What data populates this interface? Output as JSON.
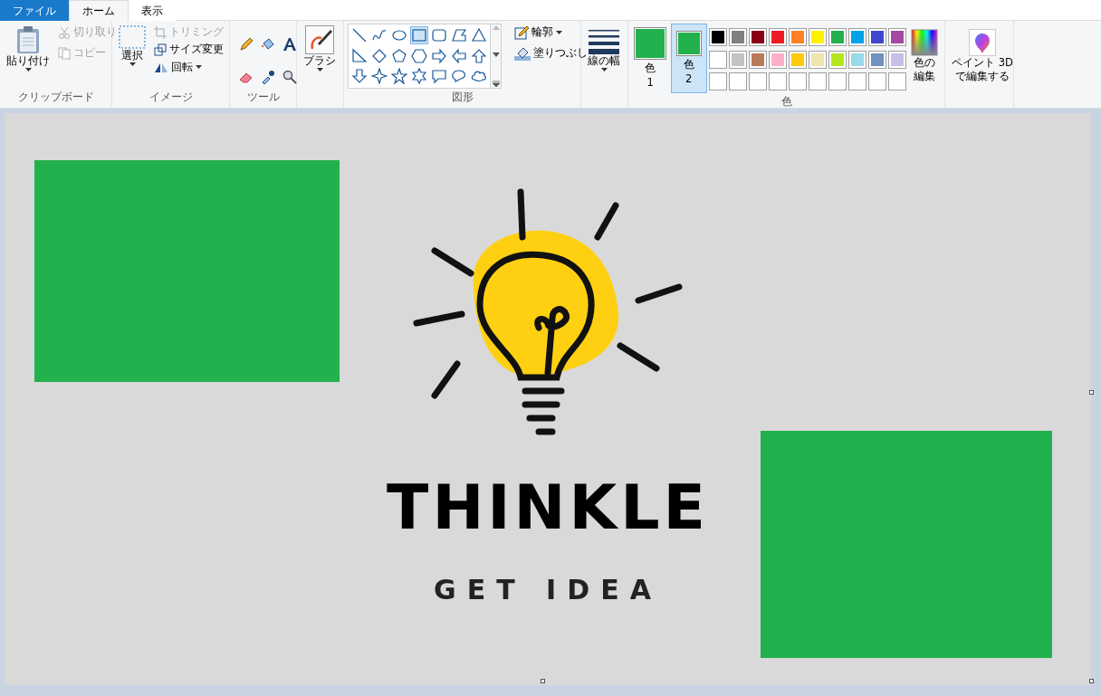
{
  "tabs": [
    {
      "label": "ファイル",
      "kind": "file",
      "selected": false
    },
    {
      "label": "ホーム",
      "kind": "tab",
      "selected": true
    },
    {
      "label": "表示",
      "kind": "tab",
      "selected": false
    }
  ],
  "clipboard": {
    "paste": "貼り付け",
    "cut": {
      "label": "切り取り",
      "disabled": true
    },
    "copy": {
      "label": "コピー",
      "disabled": true
    },
    "group_label": "クリップボード"
  },
  "image": {
    "select": "選択",
    "crop": {
      "label": "トリミング",
      "disabled": true
    },
    "resize": {
      "label": "サイズ変更",
      "disabled": false
    },
    "rotate": {
      "label": "回転",
      "disabled": false
    },
    "group_label": "イメージ"
  },
  "tools": {
    "group_label": "ツール"
  },
  "brush": {
    "label": "ブラシ"
  },
  "shapes": {
    "items": [
      {
        "kind": "line",
        "selected": false
      },
      {
        "kind": "curve",
        "selected": false
      },
      {
        "kind": "oval",
        "selected": false
      },
      {
        "kind": "rect",
        "selected": true
      },
      {
        "kind": "roundrect",
        "selected": false
      },
      {
        "kind": "polygon",
        "selected": false
      },
      {
        "kind": "triangle",
        "selected": false
      },
      {
        "kind": "righttri",
        "selected": false
      },
      {
        "kind": "diamond",
        "selected": false
      },
      {
        "kind": "pentagon",
        "selected": false
      },
      {
        "kind": "hexagon",
        "selected": false
      },
      {
        "kind": "arrowright",
        "selected": false
      },
      {
        "kind": "arrowleft",
        "selected": false
      },
      {
        "kind": "arrowup",
        "selected": false
      },
      {
        "kind": "arrowdown",
        "selected": false
      },
      {
        "kind": "star4",
        "selected": false
      },
      {
        "kind": "star5",
        "selected": false
      },
      {
        "kind": "star6",
        "selected": false
      },
      {
        "kind": "callout",
        "selected": false
      },
      {
        "kind": "ovalcallout",
        "selected": false
      },
      {
        "kind": "cloud",
        "selected": false
      }
    ],
    "outline": "輪郭",
    "fill": "塗りつぶし",
    "group_label": "図形"
  },
  "line_width": {
    "label": "線の幅"
  },
  "colors": {
    "current": [
      {
        "label": "色",
        "number": "1",
        "color": "#22b14c",
        "selected": false
      },
      {
        "label": "色",
        "number": "2",
        "color": "#22b14c",
        "selected": true
      }
    ],
    "palette": [
      {
        "color": "#000000"
      },
      {
        "color": "#7f7f7f"
      },
      {
        "color": "#880015"
      },
      {
        "color": "#ed1c24"
      },
      {
        "color": "#ff7f27"
      },
      {
        "color": "#fff200"
      },
      {
        "color": "#22b14c"
      },
      {
        "color": "#00a2e8"
      },
      {
        "color": "#3f48cc"
      },
      {
        "color": "#a349a4"
      },
      {
        "color": "#ffffff"
      },
      {
        "color": "#c3c3c3"
      },
      {
        "color": "#b97a57"
      },
      {
        "color": "#ffaec9"
      },
      {
        "color": "#ffc90e"
      },
      {
        "color": "#efe4b0"
      },
      {
        "color": "#b5e61d"
      },
      {
        "color": "#99d9ea"
      },
      {
        "color": "#7092be"
      },
      {
        "color": "#c8bfe7"
      }
    ],
    "edit_colors": [
      "色の",
      "編集"
    ],
    "group_label": "色"
  },
  "paint3d": {
    "lines": [
      "ペイント 3D",
      "で編集する"
    ]
  },
  "canvas": {
    "title": "THINKLE",
    "tagline": "GET IDEA"
  }
}
